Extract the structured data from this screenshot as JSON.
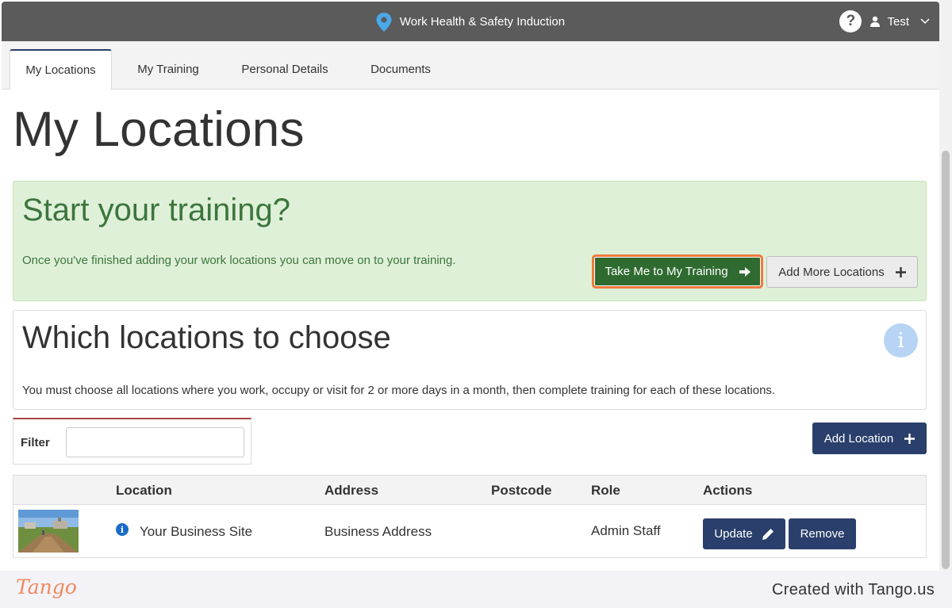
{
  "topbar": {
    "app_title": "Work Health & Safety Induction",
    "help_glyph": "?",
    "user_name": "Test",
    "icons": [
      "location-pin-icon",
      "help-icon",
      "user-icon",
      "chevron-down-icon"
    ]
  },
  "tabs": [
    {
      "label": "My Locations",
      "active": true
    },
    {
      "label": "My Training",
      "active": false
    },
    {
      "label": "Personal Details",
      "active": false
    },
    {
      "label": "Documents",
      "active": false
    }
  ],
  "page": {
    "title": "My Locations"
  },
  "training_alert": {
    "heading": "Start your training?",
    "message": "Once you've finished adding your work locations you can move on to your training.",
    "primary_button": "Take Me to My Training",
    "secondary_button": "Add More Locations"
  },
  "info_panel": {
    "heading": "Which locations to choose",
    "text": "You must choose all locations where you work, occupy or visit for 2 or more days in a month, then complete training for each of these locations.",
    "icon_glyph": "i"
  },
  "filter": {
    "label": "Filter",
    "value": "",
    "placeholder": ""
  },
  "add_location_button": "Add Location",
  "table": {
    "columns": [
      "Location",
      "Address",
      "Postcode",
      "Role",
      "Actions"
    ],
    "rows": [
      {
        "location": "Your Business Site",
        "address": "Business Address",
        "postcode": "",
        "role": "Admin Staff",
        "update_label": "Update",
        "remove_label": "Remove"
      }
    ]
  },
  "footer": {
    "logo": "Tango",
    "credit": "Created with Tango.us"
  },
  "colors": {
    "topbar": "#5b5b5b",
    "navy": "#2a3f6b",
    "green_button": "#2f6b30",
    "highlight": "#ef7a3e",
    "alert_bg": "#dff0d8",
    "alert_text": "#3c763d",
    "tango_orange": "#f08a5d"
  }
}
